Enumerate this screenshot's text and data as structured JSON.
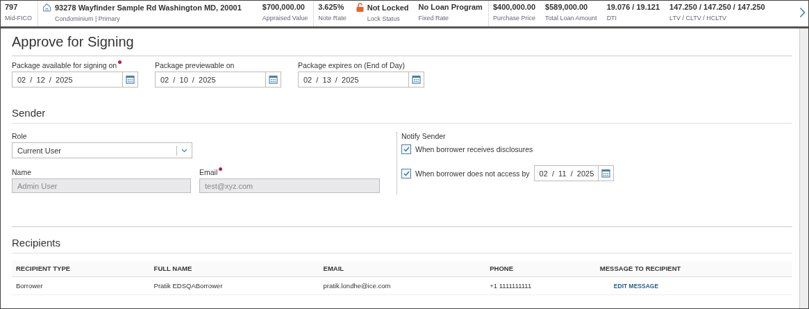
{
  "header": {
    "items": [
      {
        "kind": "stat",
        "value": "797",
        "label": "Mid-FICO",
        "divider": true
      },
      {
        "kind": "address",
        "value": "93278 Wayfinder Sample Rd Washington MD, 20001",
        "label": "Condominium | Primary"
      },
      {
        "kind": "stat",
        "value": "$700,000.00",
        "label": "Appraised Value",
        "divider": true
      },
      {
        "kind": "stat",
        "value": "3.625%",
        "label": "Note Rate"
      },
      {
        "kind": "lock",
        "value": "Not Locked",
        "label": "Lock Status"
      },
      {
        "kind": "stat",
        "value": "No Loan Program",
        "label": "Fixed Rate",
        "divider": true
      },
      {
        "kind": "stat",
        "value": "$400,000.00",
        "label": "Purchase Price"
      },
      {
        "kind": "stat",
        "value": "$589,000.00",
        "label": "Total Loan Amount"
      },
      {
        "kind": "stat",
        "value": "19.076 / 19.121",
        "label": "DTI"
      },
      {
        "kind": "stat",
        "value": "147.250 / 147.250 / 147.250",
        "label": "LTV / CLTV / HCLTV"
      }
    ]
  },
  "title": "Approve for Signing",
  "dates": [
    {
      "label": "Package available for signing on",
      "required": true,
      "value": "02  /  12  /  2025"
    },
    {
      "label": "Package previewable on",
      "required": false,
      "value": "02  /  10  /  2025"
    },
    {
      "label": "Package expires on (End of Day)",
      "required": false,
      "value": "02  /  13  /  2025"
    }
  ],
  "sender": {
    "heading": "Sender",
    "role": {
      "label": "Role",
      "value": "Current User"
    },
    "name": {
      "label": "Name",
      "required": false,
      "disabled": true,
      "value": "Admin User"
    },
    "email": {
      "label": "Email",
      "required": true,
      "disabled": true,
      "value": "test@xyz.com"
    },
    "notify": {
      "label": "Notify Sender",
      "options": [
        {
          "label": "When borrower receives disclosures",
          "checked": true
        },
        {
          "label": "When borrower does not access by",
          "checked": true,
          "date": "02  /  11  /  2025"
        }
      ]
    }
  },
  "recipients": {
    "heading": "Recipients",
    "columns": [
      "RECIPIENT TYPE",
      "FULL NAME",
      "EMAIL",
      "PHONE",
      "MESSAGE TO RECIPIENT"
    ],
    "rows": [
      {
        "type": "Borrower",
        "name": "Pratik EDSQABorrower",
        "email": "pratik.londhe@ice.com",
        "phone": "+1 1111111111",
        "action": "EDIT MESSAGE"
      }
    ]
  }
}
